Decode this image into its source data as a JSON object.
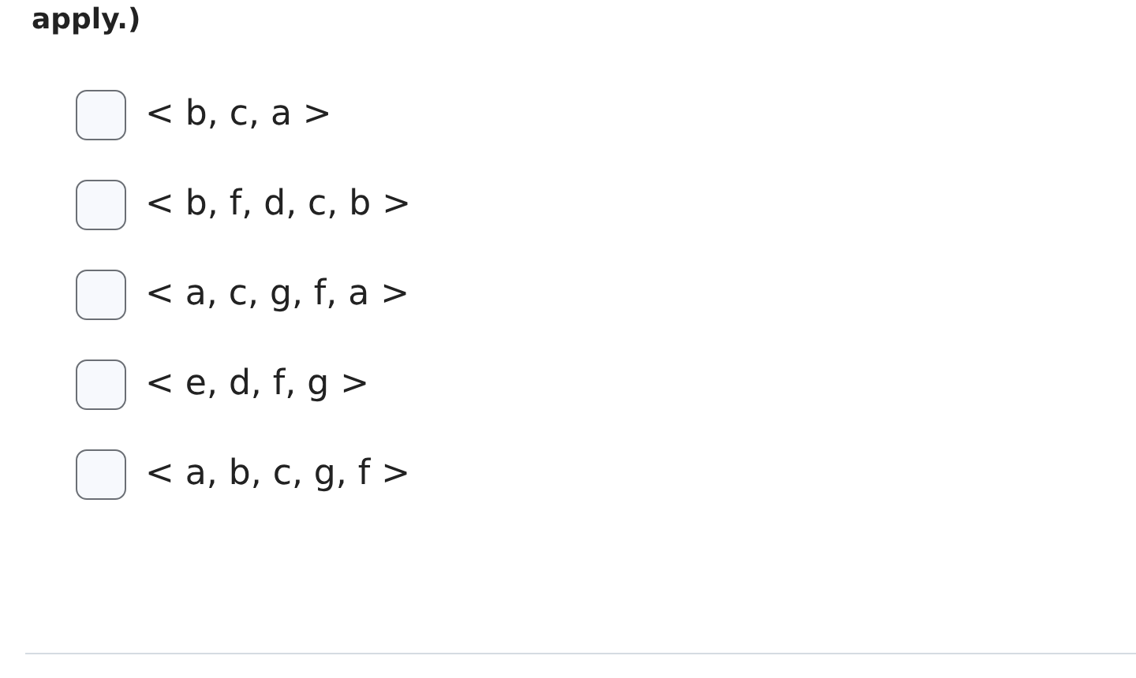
{
  "instruction_tail": "apply.)",
  "options": [
    {
      "label": "< b, c, a >",
      "checked": false
    },
    {
      "label": "< b, f, d, c, b >",
      "checked": false
    },
    {
      "label": "< a, c, g, f, a >",
      "checked": false
    },
    {
      "label": "< e, d, f, g >",
      "checked": false
    },
    {
      "label": "< a, b, c, g, f >",
      "checked": false
    }
  ]
}
